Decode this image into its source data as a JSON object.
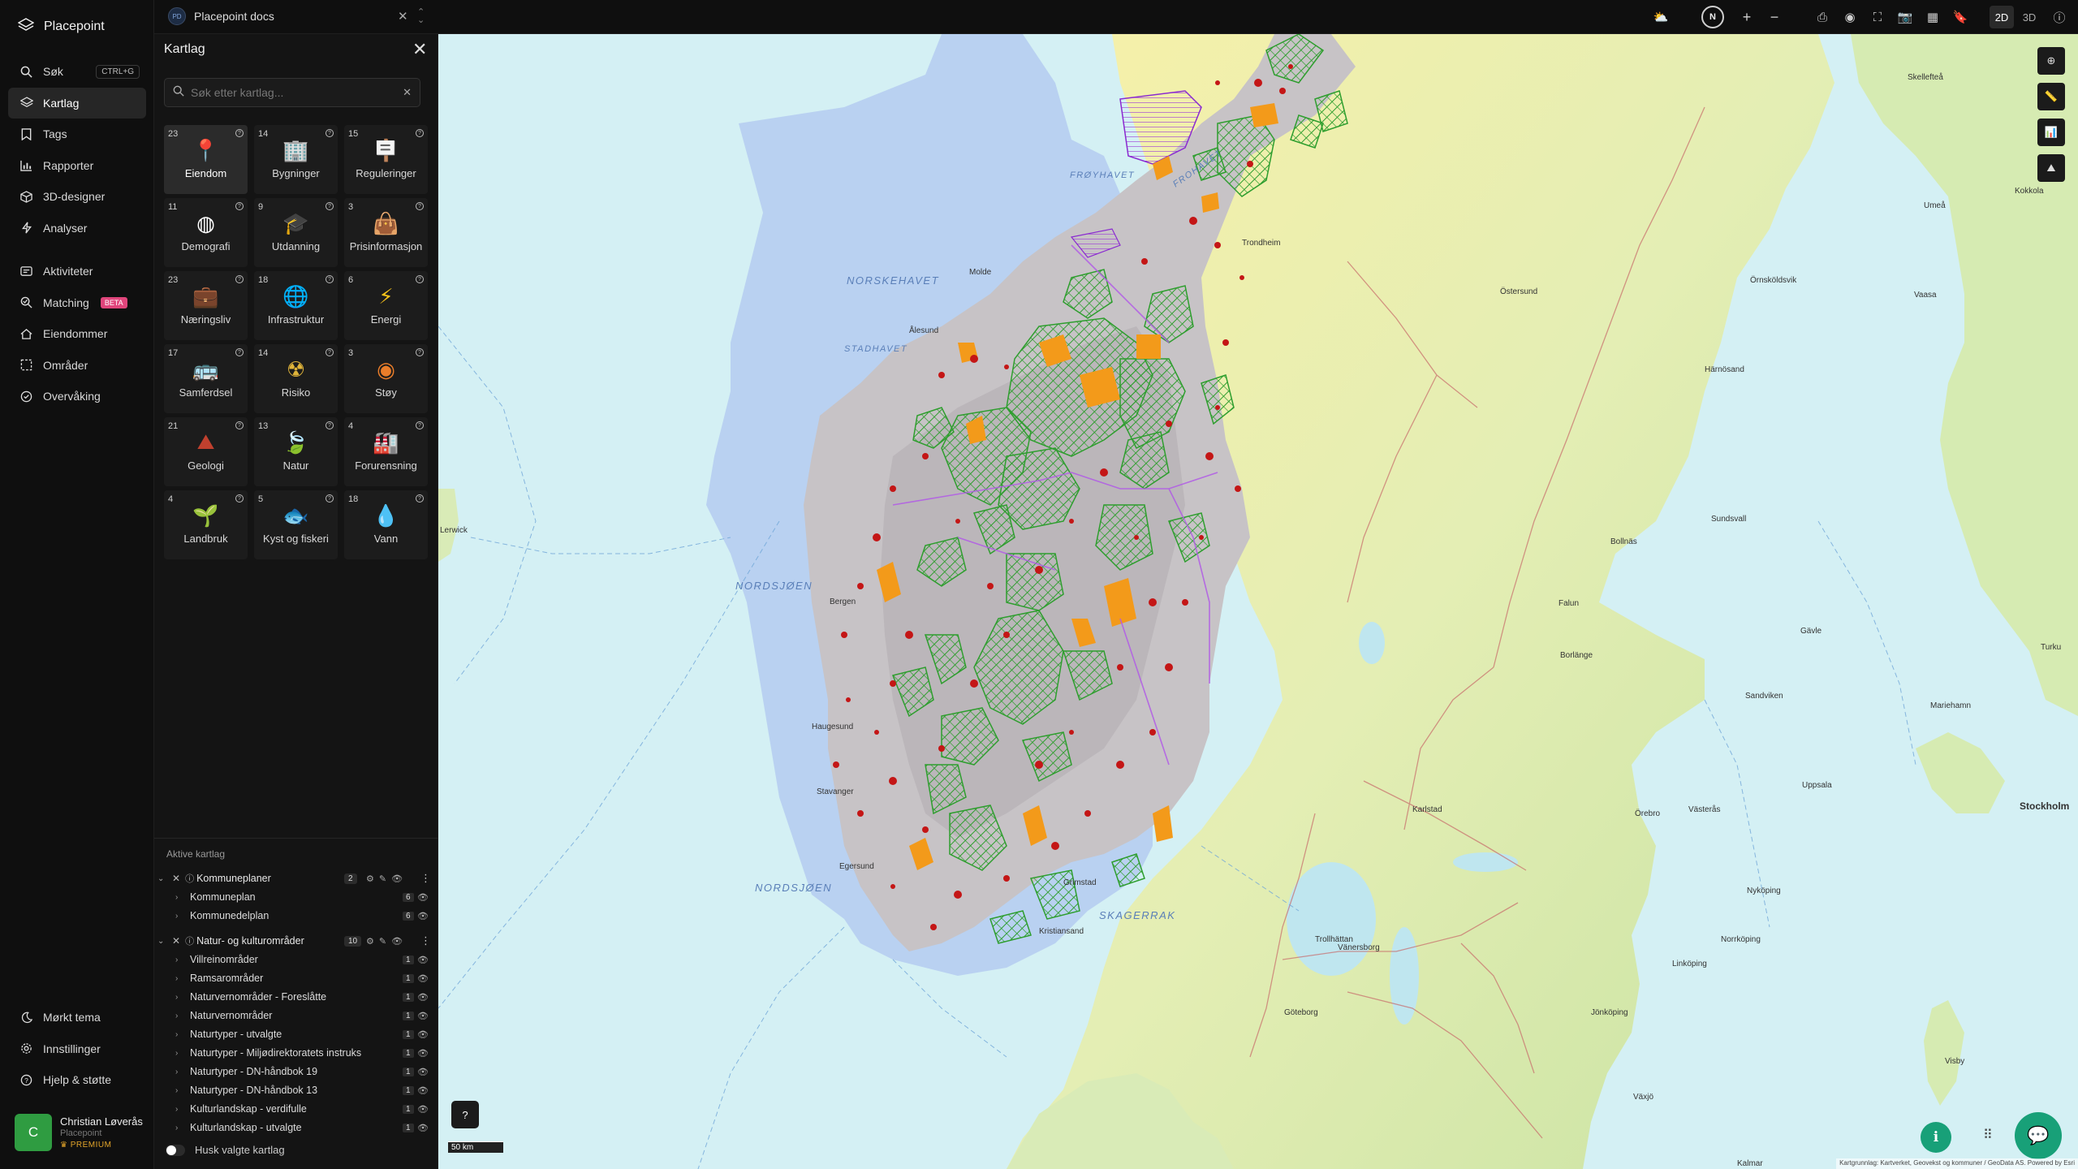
{
  "app": {
    "name": "Placepoint"
  },
  "nav": {
    "items": [
      {
        "label": "Søk",
        "icon": "search-icon",
        "shortcut": "CTRL+G"
      },
      {
        "label": "Kartlag",
        "icon": "layers-icon",
        "active": true
      },
      {
        "label": "Tags",
        "icon": "bookmark-icon"
      },
      {
        "label": "Rapporter",
        "icon": "bar-chart-icon"
      },
      {
        "label": "3D-designer",
        "icon": "cube-icon"
      },
      {
        "label": "Analyser",
        "icon": "bolt-icon"
      }
    ],
    "items2": [
      {
        "label": "Aktiviteter",
        "icon": "activity-icon"
      },
      {
        "label": "Matching",
        "icon": "matching-icon",
        "badge": "BETA"
      },
      {
        "label": "Eiendommer",
        "icon": "property-icon"
      },
      {
        "label": "Områder",
        "icon": "area-icon"
      },
      {
        "label": "Overvåking",
        "icon": "monitor-icon"
      }
    ],
    "bottom": [
      {
        "label": "Mørkt tema",
        "icon": "moon-icon"
      },
      {
        "label": "Innstillinger",
        "icon": "gear-icon"
      },
      {
        "label": "Hjelp & støtte",
        "icon": "help-icon"
      }
    ]
  },
  "user": {
    "initial": "C",
    "name": "Christian Løverås",
    "org": "Placepoint",
    "plan": "PREMIUM"
  },
  "topbar": {
    "workspace_badge": "PD",
    "workspace": "Placepoint docs",
    "north": "N",
    "mode_2d": "2D",
    "mode_3d": "3D"
  },
  "panel": {
    "title": "Kartlag",
    "search_placeholder": "Søk etter kartlag...",
    "categories": [
      {
        "count": "23",
        "label": "Eiendom",
        "icon": "property-pin-icon",
        "active": true
      },
      {
        "count": "14",
        "label": "Bygninger",
        "icon": "building-icon"
      },
      {
        "count": "15",
        "label": "Reguleringer",
        "icon": "signpost-icon"
      },
      {
        "count": "11",
        "label": "Demografi",
        "icon": "demography-icon"
      },
      {
        "count": "9",
        "label": "Utdanning",
        "icon": "graduation-cap-icon"
      },
      {
        "count": "3",
        "label": "Prisinformasjon",
        "icon": "shopping-bag-icon"
      },
      {
        "count": "23",
        "label": "Næringsliv",
        "icon": "business-bag-icon"
      },
      {
        "count": "18",
        "label": "Infrastruktur",
        "icon": "infrastructure-icon"
      },
      {
        "count": "6",
        "label": "Energi",
        "icon": "lightning-icon"
      },
      {
        "count": "17",
        "label": "Samferdsel",
        "icon": "bus-icon"
      },
      {
        "count": "14",
        "label": "Risiko",
        "icon": "risk-icon"
      },
      {
        "count": "3",
        "label": "Støy",
        "icon": "noise-icon"
      },
      {
        "count": "21",
        "label": "Geologi",
        "icon": "geology-icon"
      },
      {
        "count": "13",
        "label": "Natur",
        "icon": "leaf-icon"
      },
      {
        "count": "4",
        "label": "Forurensning",
        "icon": "factory-icon"
      },
      {
        "count": "4",
        "label": "Landbruk",
        "icon": "sprout-icon"
      },
      {
        "count": "5",
        "label": "Kyst og fiskeri",
        "icon": "fish-icon"
      },
      {
        "count": "18",
        "label": "Vann",
        "icon": "water-drop-icon"
      }
    ],
    "active_title": "Aktive kartlag",
    "groups": [
      {
        "name": "Kommuneplaner",
        "count": "2",
        "children": [
          {
            "name": "Kommuneplan",
            "count": "6"
          },
          {
            "name": "Kommunedelplan",
            "count": "6"
          }
        ]
      },
      {
        "name": "Natur- og kulturområder",
        "count": "10",
        "children": [
          {
            "name": "Villreinområder",
            "count": "1"
          },
          {
            "name": "Ramsarområder",
            "count": "1"
          },
          {
            "name": "Naturvernområder - Foreslåtte",
            "count": "1"
          },
          {
            "name": "Naturvernområder",
            "count": "1"
          },
          {
            "name": "Naturtyper - utvalgte",
            "count": "1"
          },
          {
            "name": "Naturtyper - Miljødirektoratets instruks",
            "count": "1"
          },
          {
            "name": "Naturtyper - DN-håndbok 19",
            "count": "1"
          },
          {
            "name": "Naturtyper - DN-håndbok 13",
            "count": "1"
          },
          {
            "name": "Kulturlandskap - verdifulle",
            "count": "1"
          },
          {
            "name": "Kulturlandskap - utvalgte",
            "count": "1"
          }
        ]
      }
    ],
    "remember_label": "Husk valgte kartlag"
  },
  "map": {
    "scale": "50 km",
    "credits": "Kartgrunnlag: Kartverket, Geovekst og kommuner / GeoData AS. Powered by Esri",
    "sea_labels": [
      "NORSKEHAVET",
      "NORDSJØEN",
      "NORDSJØEN",
      "SKAGERRAK",
      "FROHAVET",
      "FRØYHAVET",
      "STADHAVET"
    ],
    "cities": [
      "Stockholm",
      "Göteborg",
      "Umeå",
      "Sundsvall",
      "Östersund",
      "Gävle",
      "Örebro",
      "Karlstad",
      "Västerås",
      "Uppsala",
      "Jönköping",
      "Linköping",
      "Norrköping",
      "Skellefteå",
      "Örnsköldsvik",
      "Härnösand",
      "Bollnäs",
      "Borlänge",
      "Vänersborg",
      "Växjö",
      "Kokkola",
      "Vaasa",
      "Turku",
      "Mariehamn",
      "Lerwick",
      "Kalmar",
      "Visby",
      "Trollhättan",
      "Nyköping",
      "Kristiansand",
      "Stavanger",
      "Bergen",
      "Haugesund",
      "Ålesund",
      "Trondheim",
      "Molde",
      "Egersund",
      "Grimstad",
      "Falun",
      "Sandviken"
    ]
  },
  "colors": {
    "accent": "#18a078",
    "sea": "#d4f0f4",
    "land_se": "#d9e9b5",
    "norway_overlay": "#c9c6c9",
    "green_hatch": "#2e9e2e",
    "red_area": "#c41616",
    "orange_area": "#f39a1a"
  }
}
